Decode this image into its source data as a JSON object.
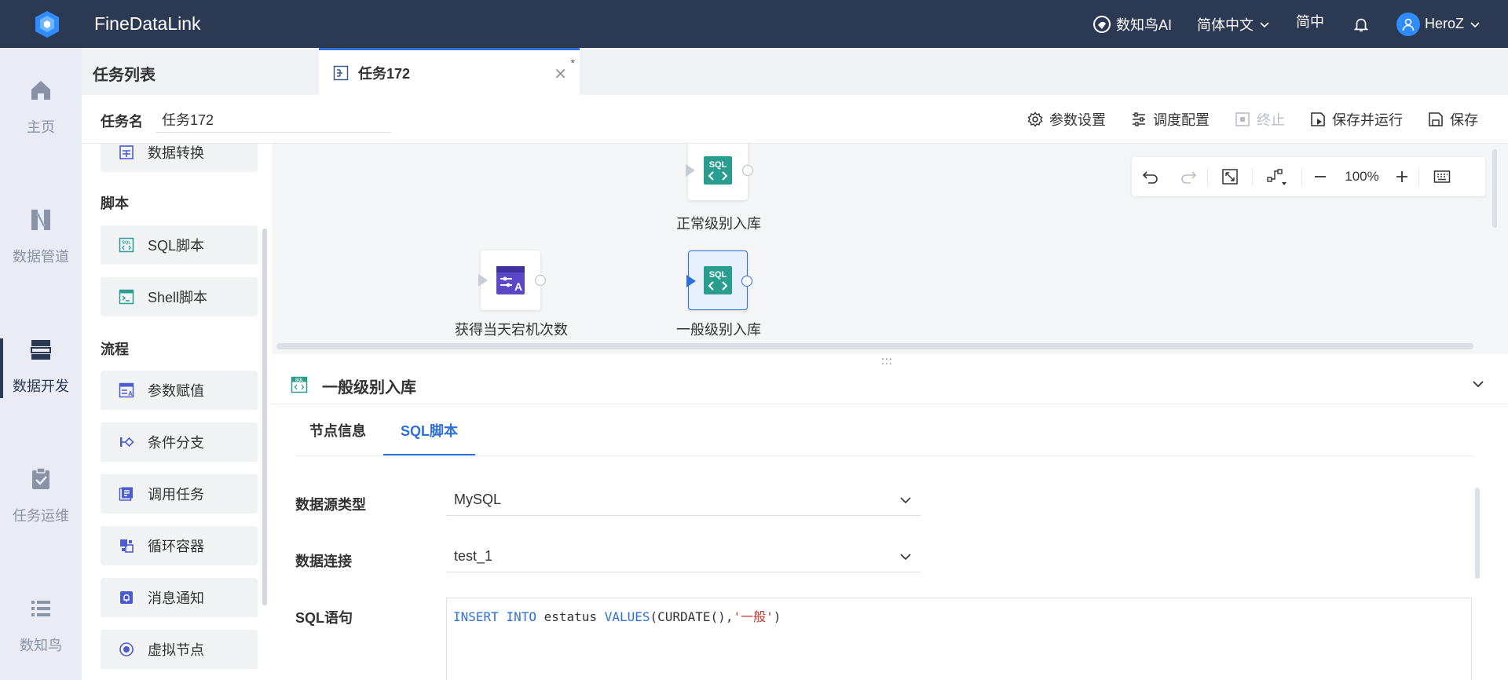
{
  "app": {
    "name": "FineDataLink"
  },
  "topbar": {
    "ai_label": "数知鸟AI",
    "language": "简体中文",
    "short_lang": "简中",
    "user": "HeroZ"
  },
  "nav": {
    "items": [
      {
        "label": "主页",
        "icon": "home-icon"
      },
      {
        "label": "数据管道",
        "icon": "pipeline-icon"
      },
      {
        "label": "数据开发",
        "icon": "data-dev-icon"
      },
      {
        "label": "任务运维",
        "icon": "task-ops-icon"
      },
      {
        "label": "数知鸟",
        "icon": "list-icon"
      }
    ]
  },
  "tabs": {
    "list_title": "任务列表",
    "file_tab_label": "任务172",
    "modified_marker": "*"
  },
  "task": {
    "name_label": "任务名",
    "name_value": "任务172"
  },
  "actions": {
    "params": "参数设置",
    "schedule": "调度配置",
    "stop": "终止",
    "save_run": "保存并运行",
    "save": "保存"
  },
  "components": {
    "top_item": "数据转换",
    "section_script": "脚本",
    "sql_script": "SQL脚本",
    "shell_script": "Shell脚本",
    "section_flow": "流程",
    "param_assign": "参数赋值",
    "cond_branch": "条件分支",
    "call_task": "调用任务",
    "loop_container": "循环容器",
    "message_notify": "消息通知",
    "virtual_node": "虚拟节点"
  },
  "canvas": {
    "nodes": [
      {
        "label": "正常级别入库",
        "type": "sql"
      },
      {
        "label": "获得当天宕机次数",
        "type": "param"
      },
      {
        "label": "一般级别入库",
        "type": "sql",
        "selected": true
      }
    ],
    "zoom": "100%"
  },
  "detail": {
    "drag_handle": ":::",
    "title": "一般级别入库",
    "tabs": [
      "节点信息",
      "SQL脚本"
    ],
    "active_tab": "SQL脚本",
    "fields": {
      "datasource_type_label": "数据源类型",
      "datasource_type_value": "MySQL",
      "connection_label": "数据连接",
      "connection_value": "test_1",
      "sql_label": "SQL语句"
    },
    "sql": {
      "kw1": "INSERT",
      "kw2": "INTO",
      "table": "estatus",
      "kw3": "VALUES",
      "func": "(CURDATE(),",
      "str": "'一般'",
      "close": ")"
    }
  },
  "colors": {
    "topbar": "#2b3a52",
    "accent": "#2f6fdb",
    "sql_green": "#2a9d8f",
    "flow_purple": "#5a48c8"
  }
}
